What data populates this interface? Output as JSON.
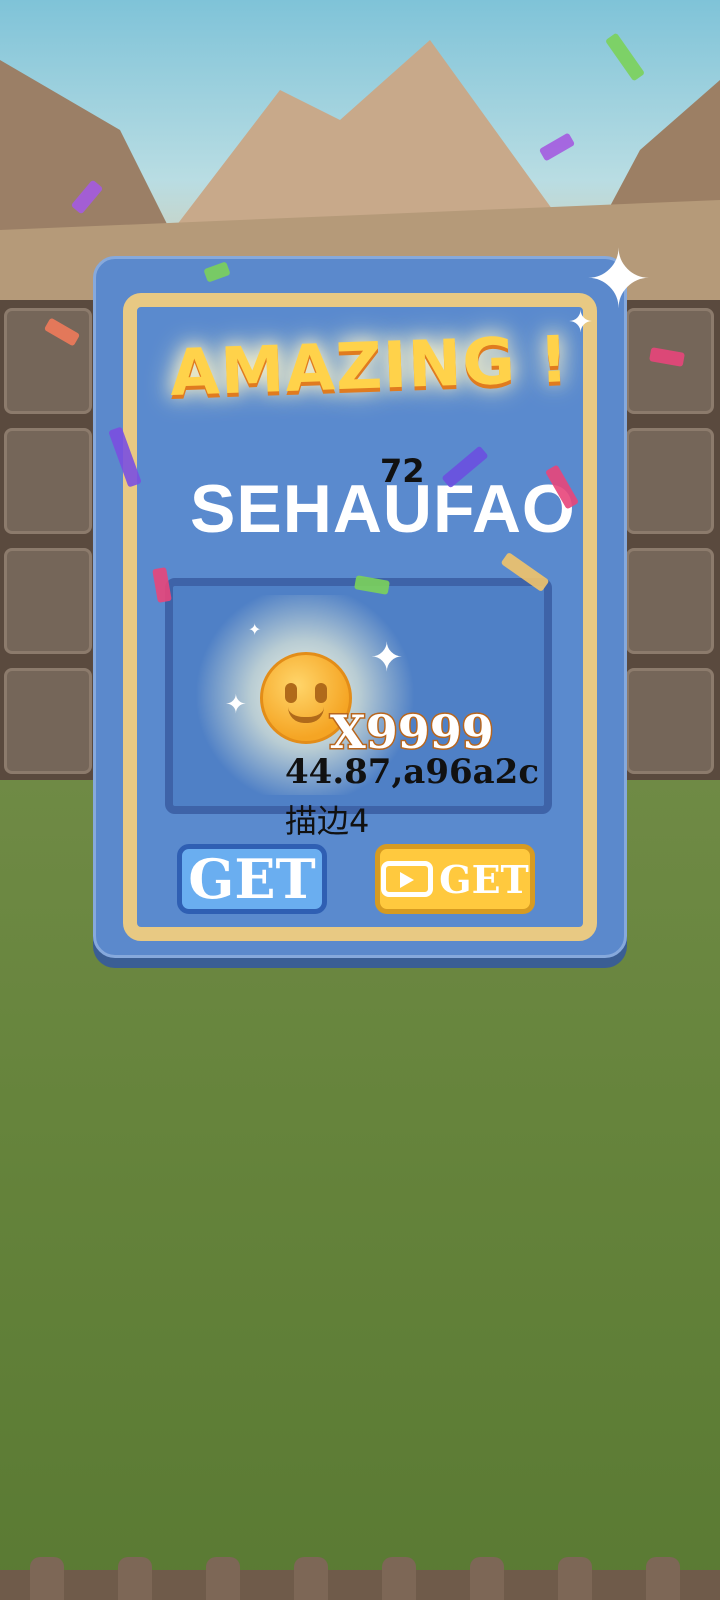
{
  "title": "AMAZING !",
  "score": "72",
  "player_name": "SEHAUFAO",
  "reward": {
    "quantity": "X9999",
    "debug_line1": "44.87,a96a2c",
    "debug_line2": "描边4",
    "icon": "coin-icon"
  },
  "buttons": {
    "get_label": "GET",
    "video_get_label": "GET"
  },
  "colors": {
    "dialog": "#5b89cc",
    "frame": "#e8c983",
    "title": "#ffd24a",
    "get_button": "#6aaef0",
    "video_button": "#ffc93e"
  }
}
